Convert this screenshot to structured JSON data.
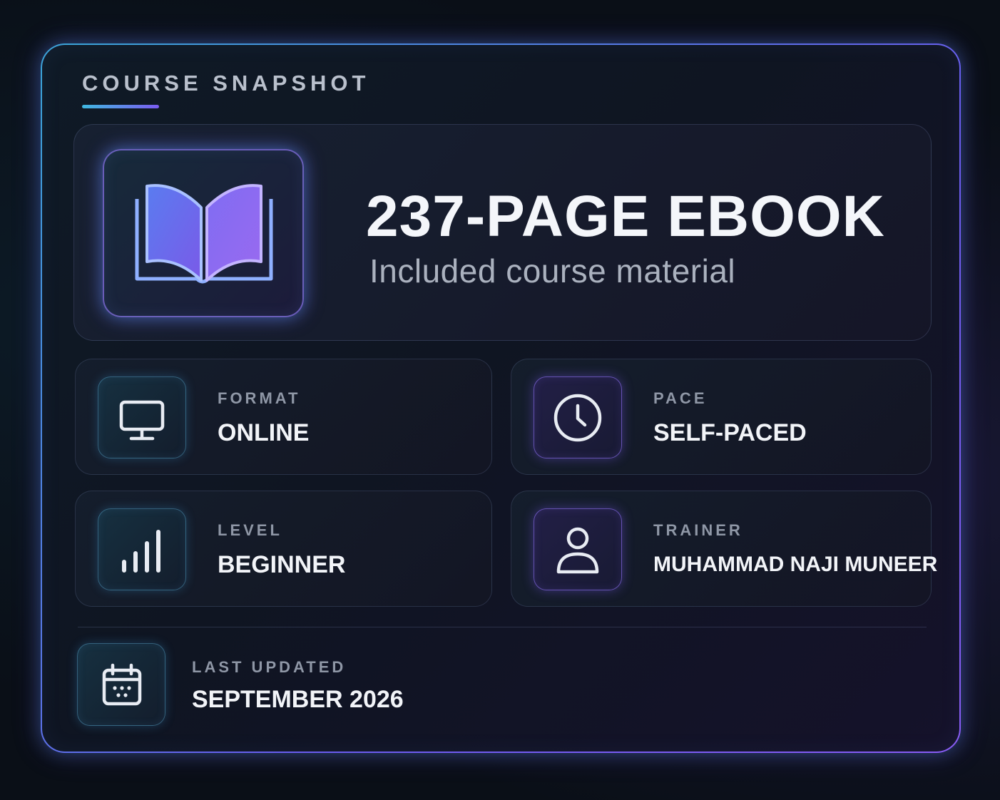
{
  "heading": "COURSE SNAPSHOT",
  "hero": {
    "title": "237-PAGE EBOOK",
    "subtitle": "Included course material",
    "icon": "open-book-icon"
  },
  "details": [
    {
      "label": "FORMAT",
      "value": "ONLINE",
      "icon": "monitor-icon"
    },
    {
      "label": "PACE",
      "value": "SELF-PACED",
      "icon": "clock-icon"
    },
    {
      "label": "LEVEL",
      "value": "BEGINNER",
      "icon": "bar-chart-icon"
    },
    {
      "label": "TRAINER",
      "value": "MUHAMMAD NAJI MUNEER",
      "icon": "user-icon"
    }
  ],
  "updated": {
    "label": "LAST UPDATED",
    "value": "SEPTEMBER 2026",
    "icon": "calendar-icon"
  },
  "colors": {
    "accent_cyan": "#3fb8e0",
    "accent_purple": "#7b5cf0",
    "background": "#0a0f17",
    "text_primary": "#f2f4f8",
    "text_muted": "#8f97a6"
  }
}
